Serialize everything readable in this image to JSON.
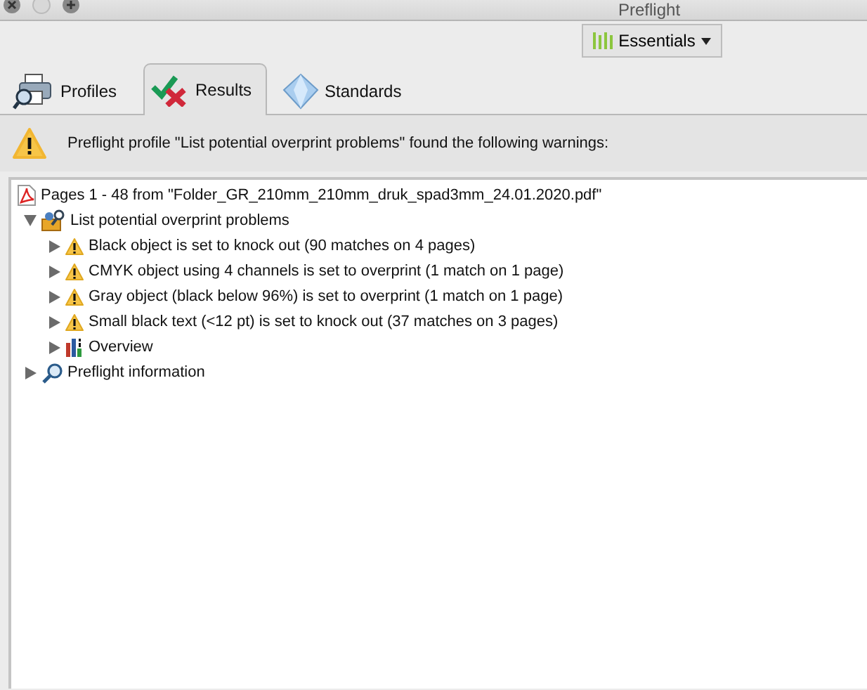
{
  "window": {
    "title": "Preflight"
  },
  "workspace_button": {
    "label": "Essentials"
  },
  "tabs": [
    {
      "label": "Profiles",
      "kind": "profiles",
      "selected": false
    },
    {
      "label": "Results",
      "kind": "results",
      "selected": true
    },
    {
      "label": "Standards",
      "kind": "standards",
      "selected": false
    }
  ],
  "message": "Preflight profile \"List potential overprint problems\" found the following warnings:",
  "tree": {
    "label": "Pages 1 - 48 from \"Folder_GR_210mm_210mm_druk_spad3mm_24.01.2020.pdf\"",
    "kind": "pdf",
    "children": [
      {
        "label": "List potential overprint problems",
        "kind": "profile",
        "expanded": true,
        "children": [
          {
            "label": "Black object is set to knock out (90 matches on 4 pages)",
            "kind": "warning",
            "expanded": false
          },
          {
            "label": "CMYK object using 4 channels is set to overprint (1 match on 1 page)",
            "kind": "warning",
            "expanded": false
          },
          {
            "label": "Gray object (black below 96%) is set to overprint (1 match on 1 page)",
            "kind": "warning",
            "expanded": false
          },
          {
            "label": "Small black text (<12 pt) is set to knock out (37 matches on 3 pages)",
            "kind": "warning",
            "expanded": false
          },
          {
            "label": "Overview",
            "kind": "overview",
            "expanded": false
          }
        ]
      },
      {
        "label": "Preflight information",
        "kind": "info",
        "expanded": false
      }
    ]
  }
}
